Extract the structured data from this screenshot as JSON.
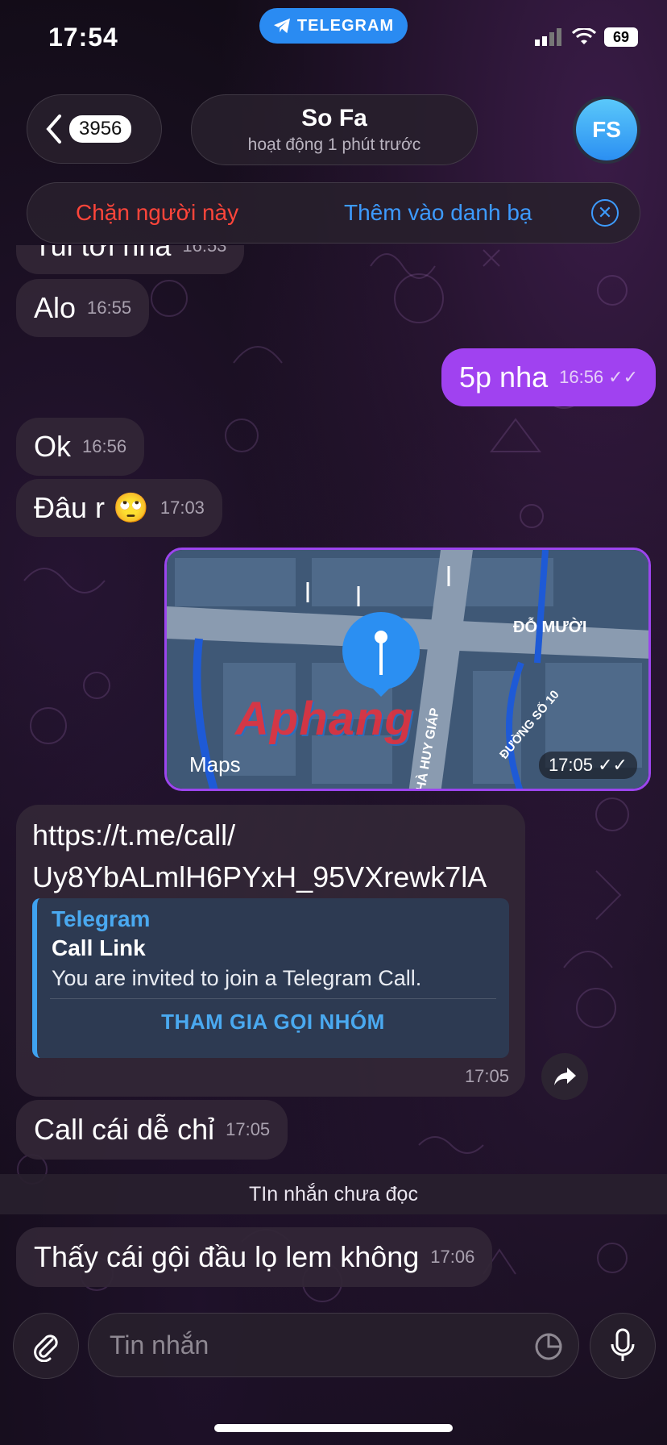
{
  "status_bar": {
    "time": "17:54",
    "app_badge": "TELEGRAM",
    "battery": "69"
  },
  "header": {
    "back_count": "3956",
    "contact_name": "So Fa",
    "contact_status": "hoạt động 1 phút trước",
    "avatar_initials": "FS"
  },
  "action_bar": {
    "block_label": "Chặn người này",
    "add_contact_label": "Thêm vào danh bạ"
  },
  "messages": [
    {
      "text": "Tui tới nha",
      "time": "16:53"
    },
    {
      "text": "Alo",
      "time": "16:55"
    },
    {
      "text": "5p nha",
      "time": "16:56"
    },
    {
      "text": "Ok",
      "time": "16:56"
    },
    {
      "text": "Đâu r 🙄",
      "time": "17:03"
    }
  ],
  "map_message": {
    "source": "Maps",
    "time": "17:05",
    "street_labels": [
      "ĐỖ MƯỜI",
      "HÀ HUY GIÁP",
      "ĐƯỜNG SỐ 10"
    ],
    "watermark": "Aphang"
  },
  "link_message": {
    "url_line1": "https://t.me/call/",
    "url_line2": "Uy8YbALmlH6PYxH_95VXrewk7lA",
    "preview_site": "Telegram",
    "preview_title": "Call Link",
    "preview_desc": "You are invited to join a Telegram Call.",
    "preview_button": "THAM GIA GỌI NHÓM",
    "time": "17:05"
  },
  "message_after_link": {
    "text": "Call cái dễ chỉ",
    "time": "17:05"
  },
  "unread_label": "TIn nhắn chưa đọc",
  "last_message": {
    "text": "Thấy cái gội đầu lọ lem không",
    "time": "17:06"
  },
  "composer": {
    "placeholder": "Tin nhắn"
  },
  "colors": {
    "outgoing": "#a042f0",
    "accent": "#3d9bff",
    "danger": "#ff453a"
  }
}
